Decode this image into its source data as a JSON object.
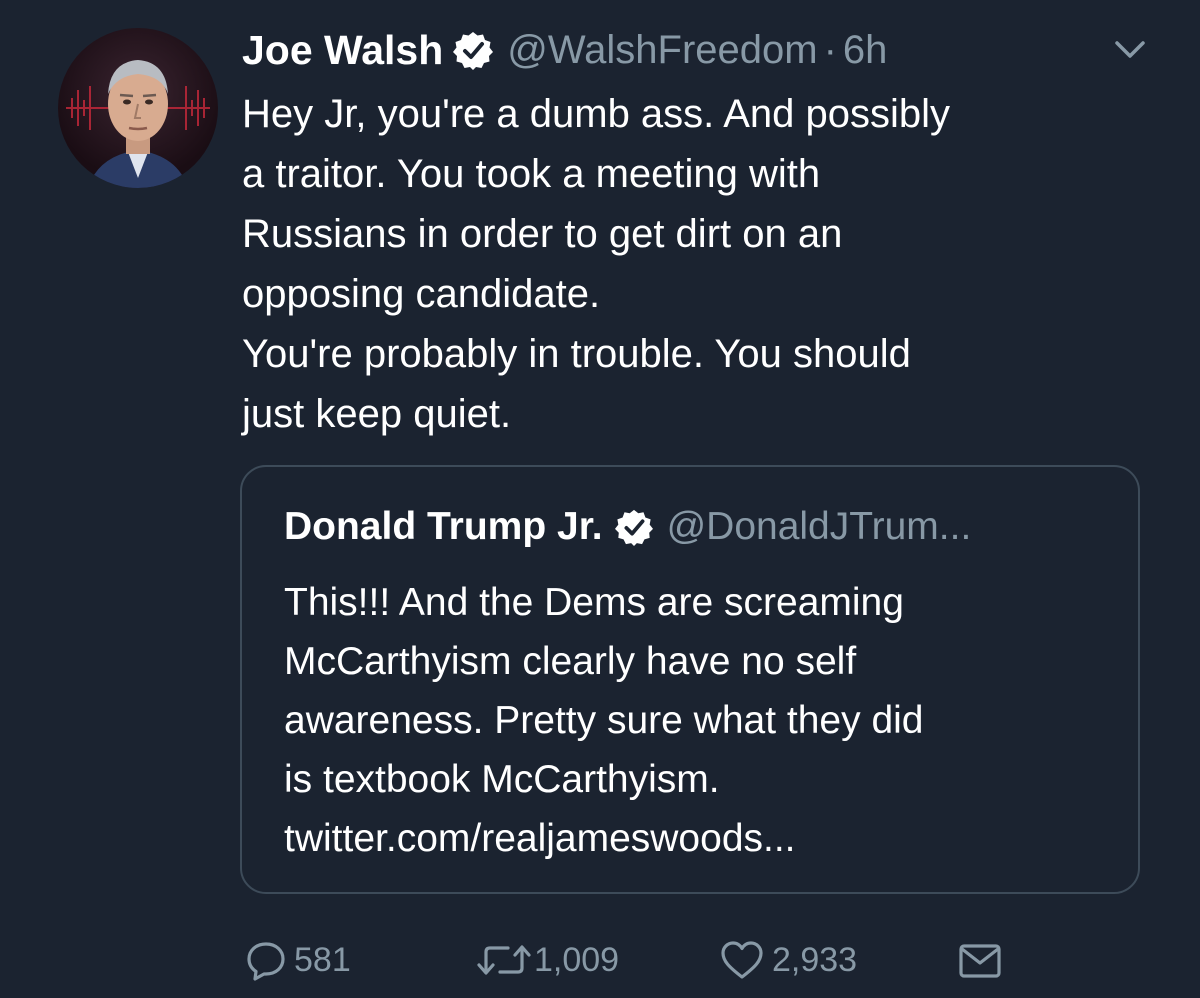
{
  "tweet": {
    "author": {
      "name": "Joe Walsh",
      "handle": "@WalshFreedom",
      "separator": "·",
      "time": "6h"
    },
    "body_lines": [
      "Hey Jr, you're a dumb ass. And possibly",
      "a traitor. You took a meeting with",
      "Russians in order to get dirt on an",
      "opposing candidate.",
      "You're probably in trouble. You should",
      "just keep quiet."
    ],
    "quoted": {
      "name": "Donald Trump Jr.",
      "handle": "@DonaldJTrum...",
      "body_lines": [
        "This!!! And the Dems are screaming",
        "McCarthyism clearly have no self",
        "awareness. Pretty sure what they did",
        "is textbook McCarthyism.",
        "twitter.com/realjameswoods..."
      ]
    },
    "actions": {
      "replies": "581",
      "retweets": "1,009",
      "likes": "2,933"
    }
  },
  "icons": {
    "verified": "verified-badge-icon",
    "menu": "chevron-down-icon",
    "reply": "reply-icon",
    "retweet": "retweet-icon",
    "like": "heart-icon",
    "message": "envelope-icon"
  },
  "colors": {
    "background": "#1b2330",
    "text": "#ffffff",
    "muted": "#8899a6",
    "border": "#3d4b59"
  }
}
